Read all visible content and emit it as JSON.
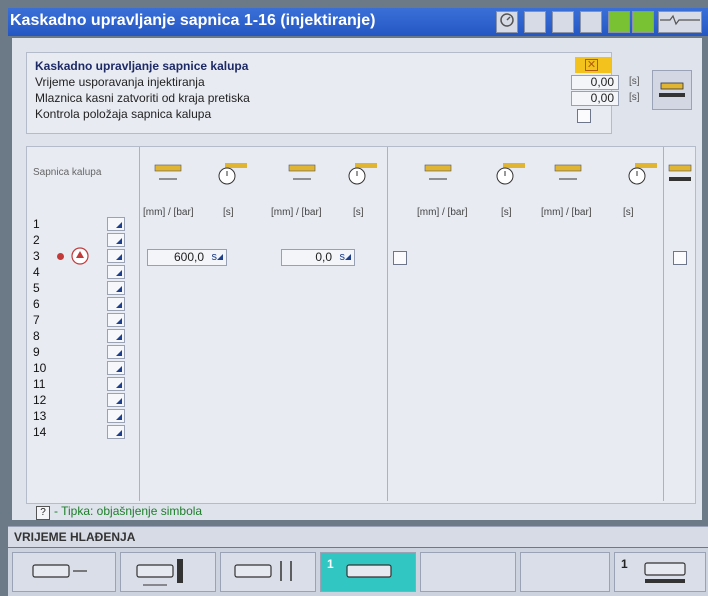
{
  "window": {
    "title": "Kaskadno upravljanje sapnica 1-16 (injektiranje)"
  },
  "settings": {
    "row1": {
      "label": "Kaskadno upravljanje sapnice kalupa"
    },
    "row2": {
      "label": "Vrijeme usporavanja injektiranja",
      "value": "0,00",
      "unit": "[s]"
    },
    "row3": {
      "label": "Mlaznica kasni zatvoriti od kraja pretiska",
      "value": "0,00",
      "unit": "[s]"
    },
    "row4": {
      "label": "Kontrola položaja sapnica kalupa"
    }
  },
  "table": {
    "header_label": "Sapnica kalupa",
    "units": [
      "[mm] / [bar]",
      "[s]",
      "[mm] / [bar]",
      "[s]",
      "[mm] / [bar]",
      "[s]",
      "[mm] / [bar]",
      "[s]"
    ],
    "rows": [
      "1",
      "2",
      "3",
      "4",
      "5",
      "6",
      "7",
      "8",
      "9",
      "10",
      "11",
      "12",
      "13",
      "14"
    ],
    "row3": {
      "value_a": "600,0",
      "value_b": "0,0",
      "suffix": "s"
    }
  },
  "help": {
    "symbol": "?",
    "text": "- Tipka: objašnjenje simbola"
  },
  "statusbar": {
    "text": "VRIJEME HLAĐENJA"
  },
  "softkeys": {
    "active_number": "1",
    "last_number": "1"
  },
  "colors": {
    "title_bar": "#2f66d0",
    "highlight": "#f3c21c",
    "active_softkey": "#31c6c2",
    "help_text": "#1d7f2a"
  },
  "icons": [
    "clock-icon",
    "nozzle-icon",
    "timer-icon",
    "temperature-icon",
    "settings-icon"
  ]
}
